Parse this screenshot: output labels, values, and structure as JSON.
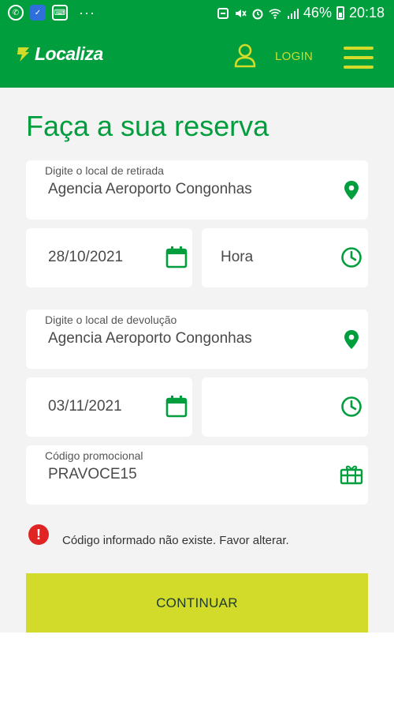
{
  "status_bar": {
    "battery": "46%",
    "time": "20:18",
    "overflow": "···"
  },
  "header": {
    "logo_text": "Localiza",
    "login_label": "LOGIN"
  },
  "main": {
    "title": "Faça a sua reserva",
    "pickup_location": {
      "label": "Digite o local de retirada",
      "value": "Agencia Aeroporto Congonhas"
    },
    "pickup_date": {
      "value": "28/10/2021"
    },
    "pickup_time": {
      "placeholder": "Hora",
      "value": ""
    },
    "return_location": {
      "label": "Digite o local de devolução",
      "value": "Agencia Aeroporto Congonhas"
    },
    "return_date": {
      "value": "03/11/2021"
    },
    "return_time": {
      "value": ""
    },
    "promo": {
      "label": "Código promocional",
      "value": "PRAVOCE15"
    },
    "error_message": "Código informado não existe. Favor alterar.",
    "continue_label": "CONTINUAR"
  },
  "colors": {
    "brand_green": "#009e3d",
    "accent_lime": "#d2db2a",
    "error_red": "#e02424",
    "background": "#f3f3f4"
  },
  "icons": [
    "whatsapp-icon",
    "shield-app-icon",
    "keyboard-app-icon",
    "user-icon",
    "hamburger-menu-icon",
    "location-pin-icon",
    "calendar-icon",
    "clock-icon",
    "gift-card-icon",
    "error-icon"
  ]
}
